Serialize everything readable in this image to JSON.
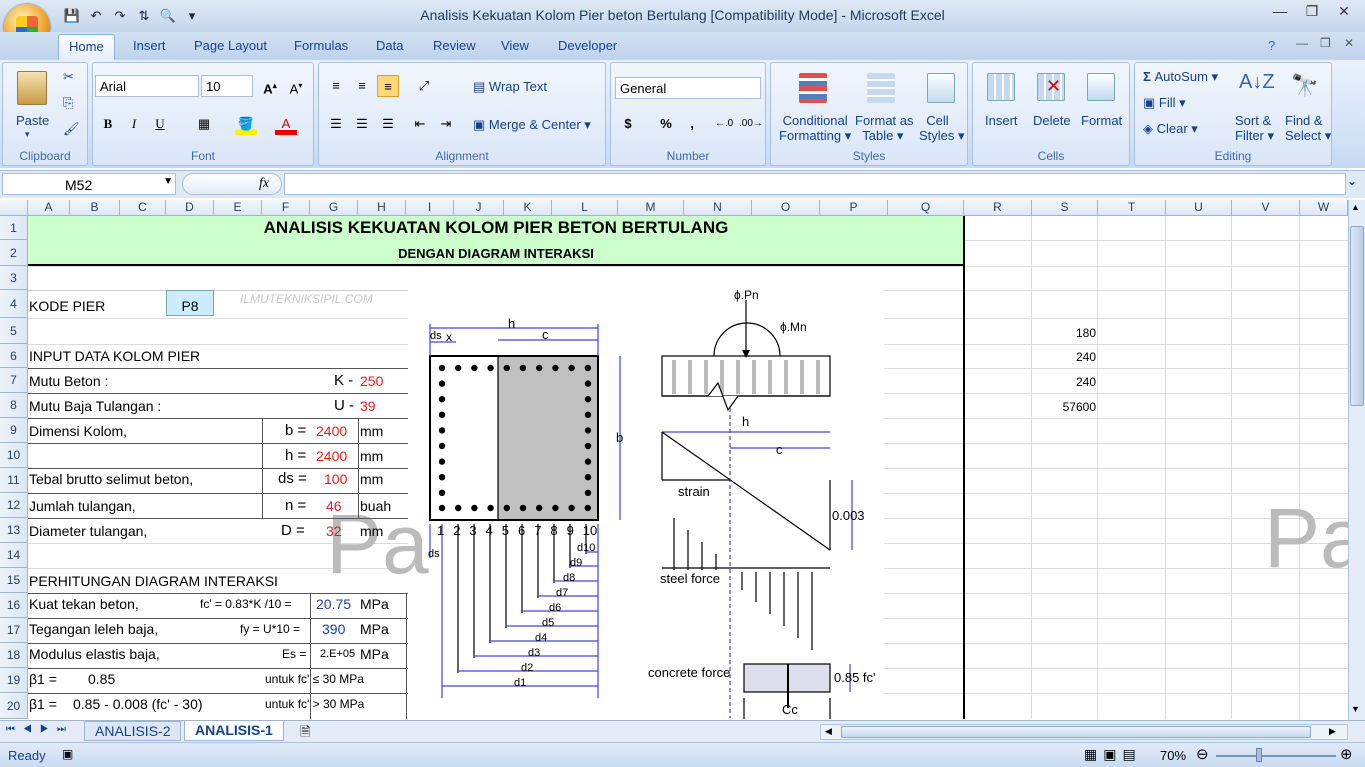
{
  "window": {
    "title": "Analisis Kekuatan Kolom Pier beton Bertulang  [Compatibility Mode] - Microsoft Excel"
  },
  "tabs": [
    "Home",
    "Insert",
    "Page Layout",
    "Formulas",
    "Data",
    "Review",
    "View",
    "Developer"
  ],
  "ribbon": {
    "clipboard": {
      "label": "Clipboard",
      "paste": "Paste"
    },
    "font": {
      "label": "Font",
      "name": "Arial",
      "size": "10",
      "bold": "B",
      "italic": "I",
      "underline": "U"
    },
    "alignment": {
      "label": "Alignment",
      "wrap": "Wrap Text",
      "merge": "Merge & Center"
    },
    "number": {
      "label": "Number",
      "format": "General",
      "currency": "$",
      "percent": "%",
      "comma": ","
    },
    "styles": {
      "label": "Styles",
      "conditional1": "Conditional",
      "conditional2": "Formatting",
      "format_as1": "Format as",
      "format_as2": "Table",
      "cell1": "Cell",
      "cell2": "Styles"
    },
    "cells": {
      "label": "Cells",
      "insert": "Insert",
      "delete": "Delete",
      "format": "Format"
    },
    "editing": {
      "label": "Editing",
      "autosum": "AutoSum",
      "fill": "Fill",
      "clear": "Clear",
      "sort1": "Sort &",
      "sort2": "Filter",
      "find1": "Find &",
      "find2": "Select"
    }
  },
  "formula_bar": {
    "name_box": "M52",
    "fx": "fx",
    "value": ""
  },
  "columns": [
    "A",
    "B",
    "C",
    "D",
    "E",
    "F",
    "G",
    "H",
    "I",
    "J",
    "K",
    "L",
    "M",
    "N",
    "O",
    "P",
    "Q",
    "R",
    "S",
    "T",
    "U",
    "V",
    "W"
  ],
  "rows": [
    "1",
    "2",
    "3",
    "4",
    "5",
    "6",
    "7",
    "8",
    "9",
    "10",
    "11",
    "12",
    "13",
    "14",
    "15",
    "16",
    "17",
    "18",
    "19",
    "20"
  ],
  "sheet": {
    "title": "ANALISIS KEKUATAN KOLOM PIER BETON BERTULANG",
    "subtitle": "DENGAN DIAGRAM INTERAKSI",
    "kode_label": "KODE PIER",
    "kode_value": "P8",
    "watermark": "ILMUTEKNIKSIPIL.COM",
    "input_header": "INPUT DATA KOLOM PIER",
    "mutu_beton": "Mutu Beton :",
    "k_prefix": "K -",
    "k_val": "250",
    "mutu_baja": "Mutu Baja Tulangan :",
    "u_prefix": "U -",
    "u_val": "39",
    "dimensi": "Dimensi Kolom,",
    "b_eq": "b =",
    "b_val": "2400",
    "mm1": "mm",
    "h_eq": "h =",
    "h_val": "2400",
    "mm2": "mm",
    "tebal": "Tebal brutto selimut beton,",
    "ds_eq": "ds =",
    "ds_val": "100",
    "mm3": "mm",
    "jumlah": "Jumlah tulangan,",
    "n_eq": "n =",
    "n_val": "46",
    "buah": "buah",
    "diameter": "Diameter tulangan,",
    "d_eq": "D =",
    "d_val": "32",
    "mm4": "mm",
    "perhitungan": "PERHITUNGAN DIAGRAM INTERAKSI",
    "kuat": "Kuat tekan beton,",
    "fc_formula": "fc' = 0.83*K /10 =",
    "fc_val": "20.75",
    "mpa1": "MPa",
    "tegangan": "Tegangan leleh baja,",
    "fy_formula": "fy = U*10 =",
    "fy_val": "390",
    "mpa2": "MPa",
    "modulus": "Modulus elastis baja,",
    "es_formula": "Es =",
    "es_val": "2.E+05",
    "mpa3": "MPa",
    "beta1": "β1 =",
    "beta1_val": "0.85",
    "beta1_cond": "untuk fc' ≤ 30 MPa",
    "beta2": "β1 =",
    "beta2_val": "0.85 - 0.008 (fc' - 30)",
    "beta2_cond": "untuk fc' > 30 MPa",
    "s5": "180",
    "s6": "240",
    "s7": "240",
    "s8": "57600",
    "pa": "Pa"
  },
  "diagram": {
    "h": "h",
    "c": "c",
    "b": "b",
    "ds": "ds",
    "x": "x",
    "phi_p": "ϕ.Pn",
    "phi_m": "ϕ.Mn",
    "strain": "strain",
    "steel": "steel force",
    "concrete": "concrete force",
    "eps": "0.003",
    "fc085": "0.85 fc'",
    "cc": "Cc",
    "bar_numbers": [
      "1",
      "2",
      "3",
      "4",
      "5",
      "6",
      "7",
      "8",
      "9",
      "10"
    ],
    "d_labels": [
      "d1",
      "d2",
      "d3",
      "d4",
      "d5",
      "d6",
      "d7",
      "d8",
      "d9",
      "d10"
    ]
  },
  "sheet_tabs": [
    "ANALISIS-2",
    "ANALISIS-1"
  ],
  "status": {
    "ready": "Ready",
    "zoom": "70%"
  }
}
